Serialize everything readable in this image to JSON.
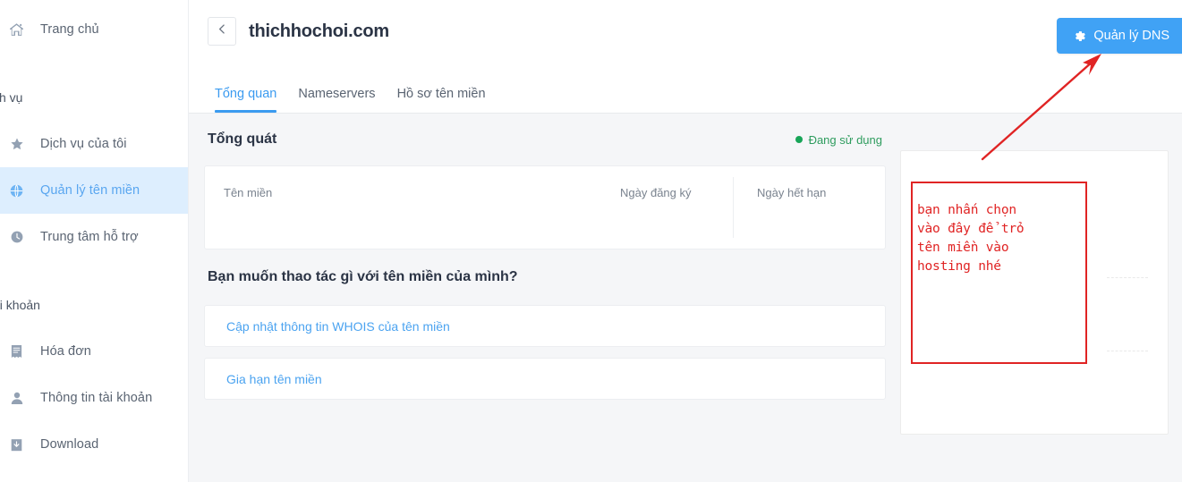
{
  "sidebar": {
    "items": [
      {
        "label": "Trang chủ",
        "icon": "home-icon",
        "active": false
      },
      {
        "label": "Dịch vụ của tôi",
        "icon": "star-icon",
        "active": false
      },
      {
        "label": "Quản lý tên miền",
        "icon": "globe-icon",
        "active": true
      },
      {
        "label": "Trung tâm hỗ trợ",
        "icon": "support-icon",
        "active": false
      },
      {
        "label": "Hóa đơn",
        "icon": "invoice-icon",
        "active": false
      },
      {
        "label": "Thông tin tài khoản",
        "icon": "user-icon",
        "active": false
      },
      {
        "label": "Download",
        "icon": "download-icon",
        "active": false
      }
    ],
    "sections": {
      "services": "ch vụ",
      "account": "ai khoản"
    }
  },
  "header": {
    "back_icon": "chevron-left-icon",
    "title": "thichhochoi.com",
    "dns_button": {
      "label": "Quản lý DNS",
      "icon": "gear-icon",
      "color": "#40a2f5"
    },
    "tabs": [
      {
        "label": "Tổng quan",
        "active": true
      },
      {
        "label": "Nameservers",
        "active": false
      },
      {
        "label": "Hồ sơ tên miền",
        "active": false
      }
    ]
  },
  "overview": {
    "section_title": "Tổng quát",
    "status": {
      "label": "Đang sử dụng",
      "color": "#18a558"
    },
    "table": {
      "columns": [
        "Tên miền",
        "Ngày đăng ký",
        "Ngày hết hạn"
      ],
      "rows": [
        {
          "Tên miền": "",
          "Ngày đăng ký": "",
          "Ngày hết hạn": ""
        }
      ]
    }
  },
  "actions": {
    "question": "Bạn muốn thao tác gì với tên miền của mình?",
    "items": [
      {
        "label": "Cập nhật thông tin WHOIS của tên miền"
      },
      {
        "label": "Gia hạn tên miền"
      }
    ]
  },
  "annotation": {
    "text": "bạn nhấn chọn\n vào đây để trỏ\ntên miền vào\nhosting nhé",
    "color": "#e02424",
    "arrow": "red-arrow-pointing-to-dns-button"
  }
}
